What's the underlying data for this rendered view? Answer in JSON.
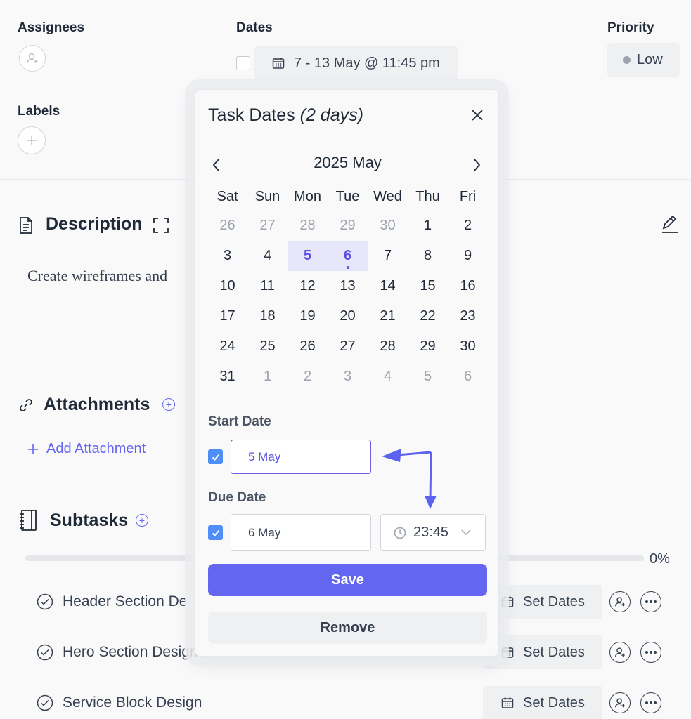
{
  "header": {
    "assignees_label": "Assignees",
    "dates_label": "Dates",
    "dates_value": "7 - 13 May @ 11:45 pm",
    "priority_label": "Priority",
    "priority_value": "Low",
    "labels_label": "Labels"
  },
  "description": {
    "title": "Description",
    "text": "Create wireframes and"
  },
  "attachments": {
    "title": "Attachments",
    "add_label": "Add Attachment"
  },
  "subtasks": {
    "title": "Subtasks",
    "progress_text": "0%",
    "progress_fraction": 0,
    "set_dates_label": "Set Dates",
    "items": [
      {
        "name": "Header Section De"
      },
      {
        "name": "Hero Section Design"
      },
      {
        "name": "Service Block Design"
      }
    ]
  },
  "popup": {
    "title": "Task Dates",
    "title_extra": "(2 days)",
    "month_label": "2025 May",
    "weekdays": [
      "Sat",
      "Sun",
      "Mon",
      "Tue",
      "Wed",
      "Thu",
      "Fri"
    ],
    "weeks": [
      [
        {
          "d": "26",
          "m": true
        },
        {
          "d": "27",
          "m": true
        },
        {
          "d": "28",
          "m": true
        },
        {
          "d": "29",
          "m": true
        },
        {
          "d": "30",
          "m": true
        },
        {
          "d": "1"
        },
        {
          "d": "2"
        }
      ],
      [
        {
          "d": "3"
        },
        {
          "d": "4"
        },
        {
          "d": "5",
          "s": true
        },
        {
          "d": "6",
          "s": true,
          "dot": true
        },
        {
          "d": "7"
        },
        {
          "d": "8"
        },
        {
          "d": "9"
        }
      ],
      [
        {
          "d": "10"
        },
        {
          "d": "11"
        },
        {
          "d": "12"
        },
        {
          "d": "13"
        },
        {
          "d": "14"
        },
        {
          "d": "15"
        },
        {
          "d": "16"
        }
      ],
      [
        {
          "d": "17"
        },
        {
          "d": "18"
        },
        {
          "d": "19"
        },
        {
          "d": "20"
        },
        {
          "d": "21"
        },
        {
          "d": "22"
        },
        {
          "d": "23"
        }
      ],
      [
        {
          "d": "24"
        },
        {
          "d": "25"
        },
        {
          "d": "26"
        },
        {
          "d": "27"
        },
        {
          "d": "28"
        },
        {
          "d": "29"
        },
        {
          "d": "30"
        }
      ],
      [
        {
          "d": "31"
        },
        {
          "d": "1",
          "m": true
        },
        {
          "d": "2",
          "m": true
        },
        {
          "d": "3",
          "m": true
        },
        {
          "d": "4",
          "m": true
        },
        {
          "d": "5",
          "m": true
        },
        {
          "d": "6",
          "m": true
        }
      ]
    ],
    "start_label": "Start Date",
    "start_value": "5 May",
    "due_label": "Due Date",
    "due_value": "6 May",
    "time_value": "23:45",
    "save_label": "Save",
    "remove_label": "Remove"
  },
  "colors": {
    "accent": "#6366f1",
    "arrow": "#5b63f0",
    "checkbox": "#4f8ef7"
  }
}
